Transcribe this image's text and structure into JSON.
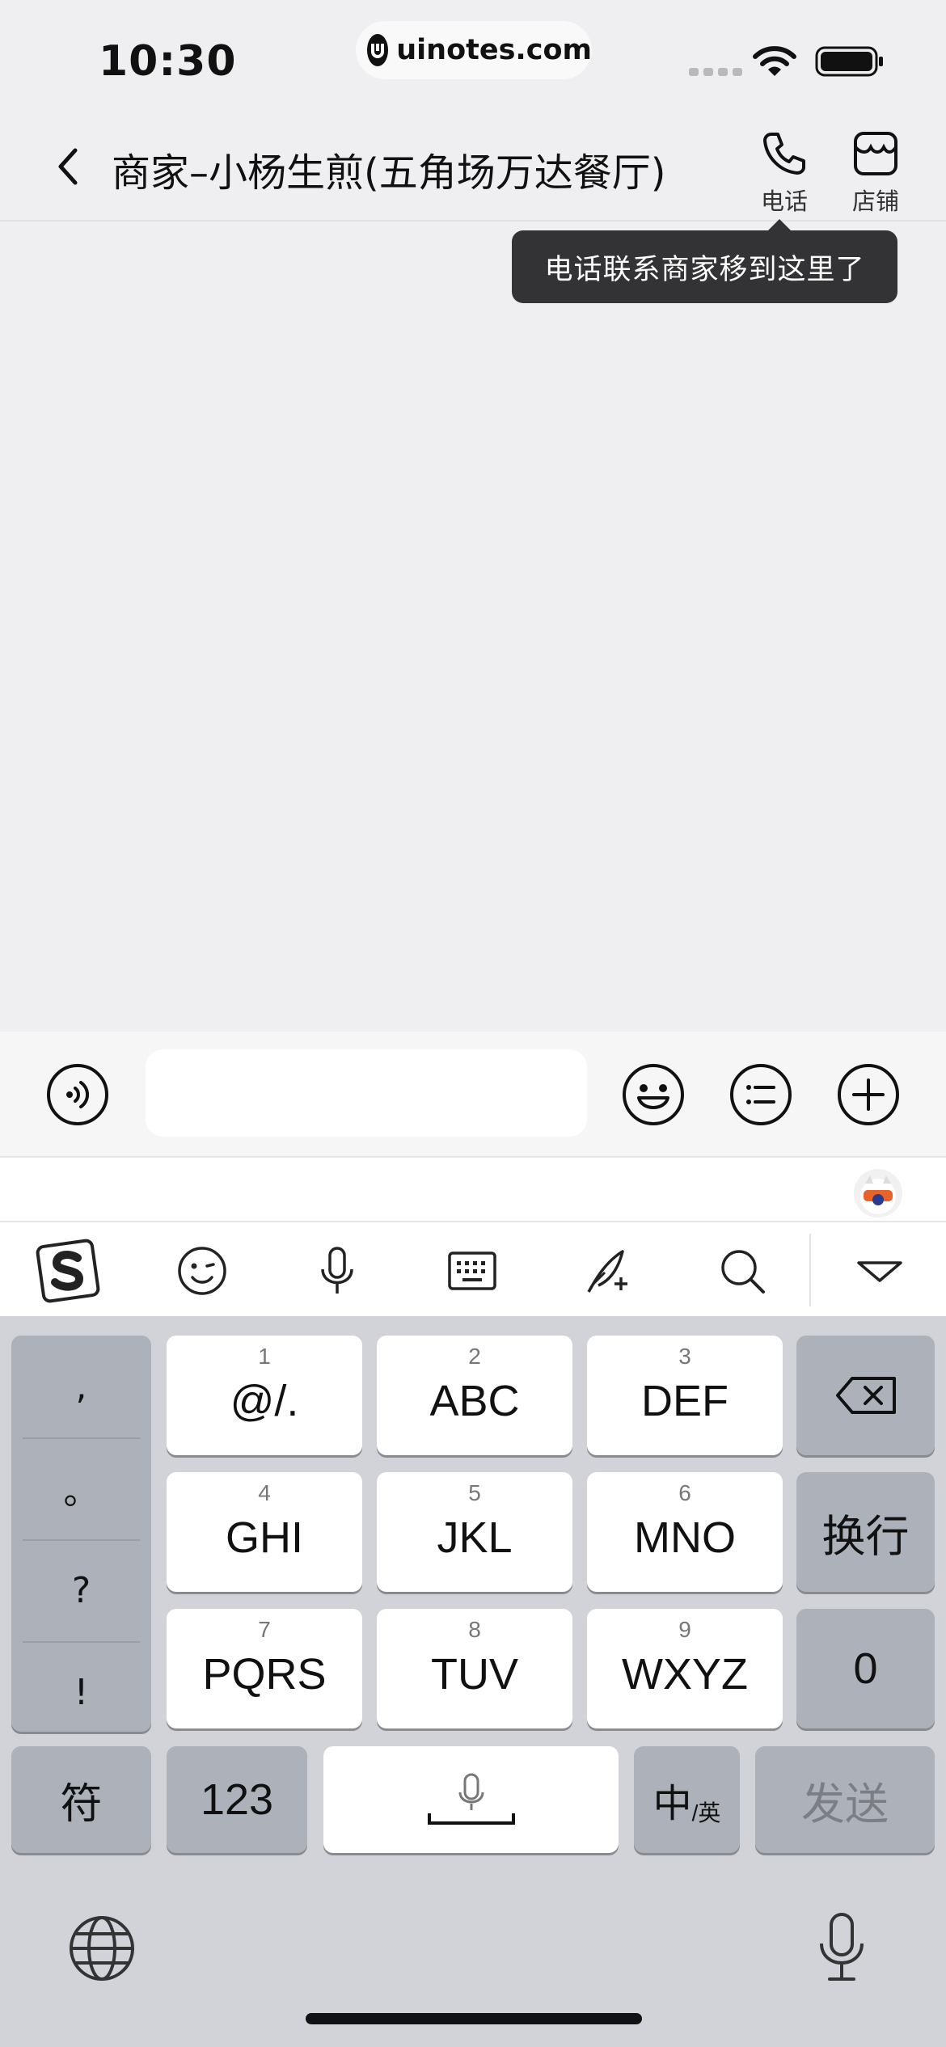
{
  "status_bar": {
    "time": "10:30",
    "url": "uinotes.com"
  },
  "nav": {
    "title": "商家–小杨生煎(五角场万达餐厅)",
    "phone_label": "电话",
    "store_label": "店铺"
  },
  "tooltip": {
    "text": "电话联系商家移到这里了"
  },
  "input_bar": {
    "message_value": ""
  },
  "keyboard": {
    "punctuation": [
      ",",
      "。",
      "?",
      "!"
    ],
    "letter_keys": [
      {
        "num": "1",
        "label": "@/."
      },
      {
        "num": "2",
        "label": "ABC"
      },
      {
        "num": "3",
        "label": "DEF"
      },
      {
        "num": "4",
        "label": "GHI"
      },
      {
        "num": "5",
        "label": "JKL"
      },
      {
        "num": "6",
        "label": "MNO"
      },
      {
        "num": "7",
        "label": "PQRS"
      },
      {
        "num": "8",
        "label": "TUV"
      },
      {
        "num": "9",
        "label": "WXYZ"
      }
    ],
    "enter_label": "换行",
    "zero_label": "0",
    "symbols_label": "符",
    "numbers_label": "123",
    "lang_main": "中",
    "lang_sub": "/英",
    "send_label": "发送"
  },
  "icons": {
    "accent": "#333335"
  }
}
